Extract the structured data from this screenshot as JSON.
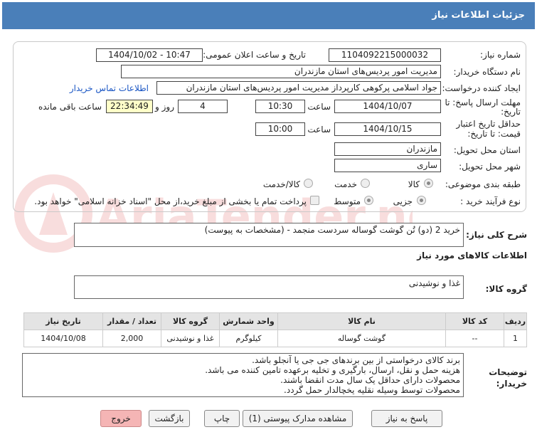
{
  "header": {
    "title": "جزئیات اطلاعات نیاز"
  },
  "fields": {
    "need_number_label": "شماره نیاز:",
    "need_number": "1104092215000032",
    "announce_label": "تاریخ و ساعت اعلان عمومی:",
    "announce_value": "1404/10/02 - 10:47",
    "buyer_label": "نام دستگاه خریدار:",
    "buyer_value": "مدیریت امور پردیس‌های استان مازندران",
    "creator_label": "ایجاد کننده درخواست:",
    "creator_value": "جواد اسلامی پرکوهی کارپرداز مدیریت امور پردیس‌های استان مازندران",
    "contact_link": "اطلاعات تماس خریدار",
    "deadline_label_1": "مهلت ارسال پاسخ: تا",
    "deadline_label_2": "تاریخ:",
    "deadline_date": "1404/10/07",
    "time_label": "ساعت",
    "deadline_time": "10:30",
    "days_value": "4",
    "days_label": "روز و",
    "remaining_time": "22:34:49",
    "remaining_label": "ساعت باقی مانده",
    "validity_label_1": "حداقل تاریخ اعتبار",
    "validity_label_2": "قیمت: تا تاریخ:",
    "validity_date": "1404/10/15",
    "validity_time": "10:00",
    "province_label": "استان محل تحویل:",
    "province_value": "مازندران",
    "city_label": "شهر محل تحویل:",
    "city_value": "ساری",
    "category_label": "طبقه بندی موضوعی:",
    "cat_goods": "کالا",
    "cat_service": "خدمت",
    "cat_goods_service": "کالا/خدمت",
    "process_label": "نوع فرآیند خرید :",
    "proc_partial": "جزیی",
    "proc_medium": "متوسط",
    "payment_note": "پرداخت تمام یا بخشی از مبلغ خرید،از محل \"اسناد خزانه اسلامی\" خواهد بود."
  },
  "summary": {
    "label": "شرح کلی نیاز:",
    "value": "خرید 2 (دو) تُن گوشت گوساله سردست منجمد - (مشخصات به پیوست)"
  },
  "goods": {
    "section_title": "اطلاعات کالاهای مورد نیاز",
    "group_label": "گروه کالا:",
    "group_value": "غذا و نوشیدنی"
  },
  "table": {
    "headers": [
      "ردیف",
      "کد کالا",
      "نام کالا",
      "واحد شمارش",
      "گروه کالا",
      "تعداد / مقدار",
      "تاریخ نیاز"
    ],
    "rows": [
      [
        "1",
        "--",
        "گوشت گوساله",
        "کیلوگرم",
        "غذا و نوشیدنی",
        "2,000",
        "1404/10/08"
      ]
    ]
  },
  "notes": {
    "label_1": "توضیحات",
    "label_2": "خریدار:",
    "lines": [
      "برند کالای درخواستی از بین برندهای جی جی یا آنجلو باشد.",
      "هزینه حمل و نقل، ارسال، بارگیری و تخلیه برعهده تامین کننده می باشد.",
      "محصولات دارای حداقل یک سال مدت انقضا باشند.",
      "محصولات توسط وسیله نقلیه یخچالدار حمل گردد."
    ]
  },
  "buttons": {
    "reply": "پاسخ به نیاز",
    "view_docs": "مشاهده مدارک پیوستی (1)",
    "print": "چاپ",
    "back": "بازگشت",
    "exit": "خروج"
  },
  "watermark": {
    "text": "AriaTender.net"
  },
  "colors": {
    "header_bg": "#4a7fb9",
    "link": "#1a56c4",
    "exit_btn": "#f5b5b5",
    "remaining_bg": "#ffffc8"
  }
}
